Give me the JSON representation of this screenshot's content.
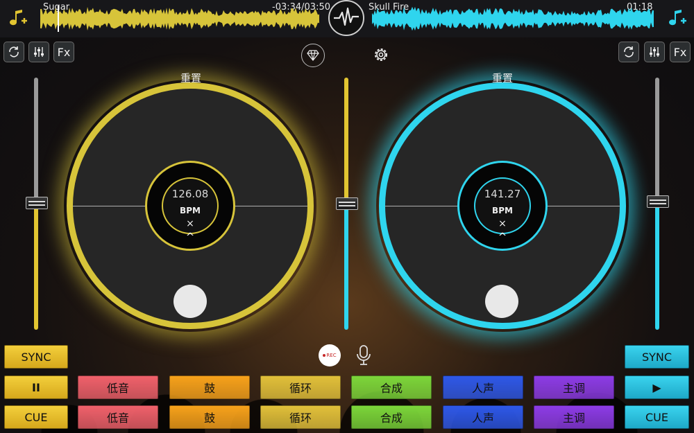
{
  "left_deck": {
    "track_title": "Sugar",
    "track_time": "-03:34/03:50",
    "reset_label": "重置",
    "bpm_value": "126.08",
    "bpm_label": "BPM",
    "close_symbol": "×",
    "caret_symbol": "^",
    "tempo_level": 0.49,
    "sync_label": "SYNC",
    "play_label": "II",
    "cue_label": "CUE",
    "toolbar": [
      "loop-icon",
      "equalizer-icon",
      "Fx"
    ],
    "accent": "#d7c43a"
  },
  "right_deck": {
    "track_title": "Skull Fire",
    "track_time": "01:18",
    "reset_label": "重置",
    "bpm_value": "141.27",
    "bpm_label": "BPM",
    "close_symbol": "×",
    "caret_symbol": "^",
    "tempo_level": 0.5,
    "sync_label": "SYNC",
    "play_label": "▶",
    "cue_label": "CUE",
    "toolbar": [
      "loop-icon",
      "equalizer-icon",
      "Fx"
    ],
    "accent": "#2fd5ee"
  },
  "center": {
    "crossfader_level": 0.5,
    "rec_label": "REC",
    "top_icons": [
      "diamond-icon",
      "gear-icon",
      "waveform-logo-icon",
      "microphone-icon",
      "music-add-icon"
    ]
  },
  "pads": {
    "row1": [
      "低音",
      "鼓",
      "循环",
      "合成",
      "人声",
      "主调"
    ],
    "row2": [
      "低音",
      "鼓",
      "循环",
      "合成",
      "人声",
      "主调"
    ],
    "colors": [
      "#f0616b",
      "#f7a21b",
      "#e1c03a",
      "#7cd63a",
      "#2e58e8",
      "#8d3ce6"
    ]
  },
  "colors": {
    "yellow": "#d7c43a",
    "cyan": "#2fd5ee",
    "rec_red": "#c62828"
  }
}
